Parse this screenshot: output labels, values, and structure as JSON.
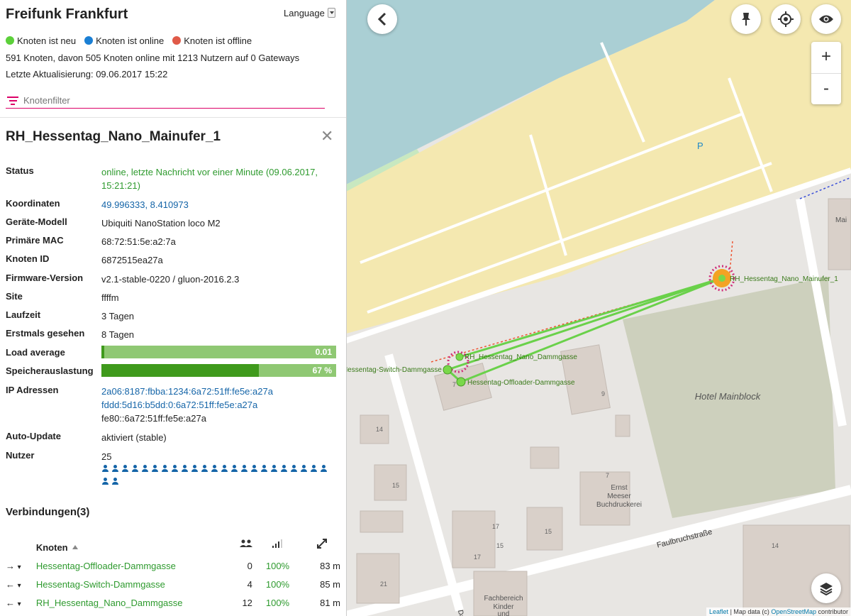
{
  "app": {
    "title": "Freifunk Frankfurt",
    "language_label": "Language",
    "legend": [
      {
        "label": "Knoten ist neu",
        "color": "#5cd03a"
      },
      {
        "label": "Knoten ist online",
        "color": "#1a7fd4"
      },
      {
        "label": "Knoten ist offline",
        "color": "#e05a48"
      }
    ],
    "stats": "591 Knoten, davon 505 Knoten online mit 1213 Nutzern auf 0 Gateways",
    "updated": "Letzte Aktualisierung: 09.06.2017 15:22",
    "filter_placeholder": "Knotenfilter",
    "accent": "#dc0067"
  },
  "node": {
    "name": "RH_Hessentag_Nano_Mainufer_1",
    "fields": [
      {
        "key": "Status",
        "value": "online, letzte Nachricht vor einer Minute (09.06.2017, 15:21:21)",
        "style": "green"
      },
      {
        "key": "Koordinaten",
        "value": "49.996333, 8.410973",
        "style": "blue"
      },
      {
        "key": "Geräte-Modell",
        "value": "Ubiquiti NanoStation loco M2",
        "style": ""
      },
      {
        "key": "Primäre MAC",
        "value": "68:72:51:5e:a2:7a",
        "style": ""
      },
      {
        "key": "Knoten ID",
        "value": "6872515ea27a",
        "style": ""
      },
      {
        "key": "Firmware-Version",
        "value": "v2.1-stable-0220 / gluon-2016.2.3",
        "style": ""
      },
      {
        "key": "Site",
        "value": "ffffm",
        "style": ""
      },
      {
        "key": "Laufzeit",
        "value": "3 Tagen",
        "style": ""
      },
      {
        "key": "Erstmals gesehen",
        "value": "8 Tagen",
        "style": ""
      }
    ],
    "load": {
      "key": "Load average",
      "label": "0.01",
      "fraction": 0.01
    },
    "memory": {
      "key": "Speicherauslastung",
      "label": "67 %",
      "fraction": 0.67
    },
    "ip": {
      "key": "IP Adressen",
      "values": [
        "2a06:8187:fbba:1234:6a72:51ff:fe5e:a27a",
        "fddd:5d16:b5dd:0:6a72:51ff:fe5e:a27a",
        "fe80::6a72:51ff:fe5e:a27a"
      ]
    },
    "autoupdate": {
      "key": "Auto-Update",
      "value": "aktiviert (stable)"
    },
    "users": {
      "key": "Nutzer",
      "value": "25",
      "count": 25
    }
  },
  "connections": {
    "title": "Verbindungen(3)",
    "header_node": "Knoten",
    "rows": [
      {
        "dir": "→",
        "name": "Hessentag-Offloader-Dammgasse",
        "clients": "0",
        "tq": "100%",
        "dist": "83 m"
      },
      {
        "dir": "←",
        "name": "Hessentag-Switch-Dammgasse",
        "clients": "4",
        "tq": "100%",
        "dist": "85 m"
      },
      {
        "dir": "←",
        "name": "RH_Hessentag_Nano_Dammgasse",
        "clients": "12",
        "tq": "100%",
        "dist": "81 m"
      }
    ]
  },
  "map": {
    "labels": {
      "main_node": "RH_Hessentag_Nano_Mainufer_1",
      "nano_dammgasse": "RH_Hessentag_Nano_Dammgasse",
      "switch": "Hessentag-Switch-Dammgasse",
      "offloader": "Hessentag-Offloader-Dammgasse",
      "hotel": "Hotel Mainblock",
      "street": "Faulbruchstraße",
      "ernst": "Ernst",
      "meeser": "Meeser",
      "druck": "Buchdruckerei",
      "fach": "Fachbereich",
      "kinder": "Kinder",
      "und": "und",
      "parking": "P",
      "mai": "Mai",
      "dar": "Dar",
      "n7a": "7",
      "n9": "9",
      "n14a": "14",
      "n15a": "15",
      "n7b": "7",
      "n17": "17",
      "n15b": "15",
      "n21": "21",
      "n14b": "14"
    },
    "zoom_in": "+",
    "zoom_out": "-",
    "attribution": {
      "leaflet": "Leaflet",
      "sep": " | Map data (c) ",
      "osm": "OpenStreetMap",
      "suffix": " contributor"
    }
  }
}
